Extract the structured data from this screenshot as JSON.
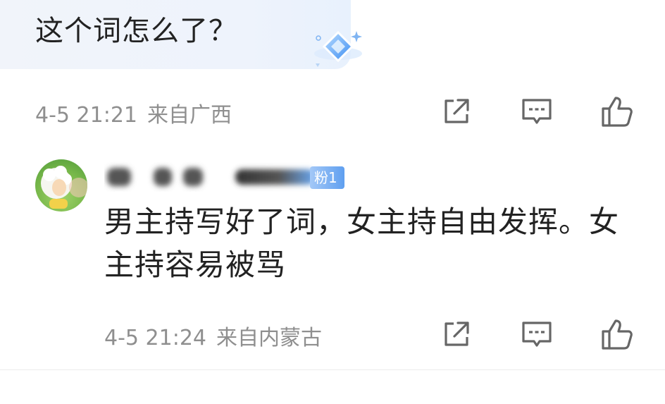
{
  "comment": {
    "text": "这个词怎么了？",
    "time": "4-5 21:21",
    "location": "来自广西"
  },
  "reply": {
    "fan_badge": "粉1",
    "text": "男主持写好了词，女主持自由发挥。女主持容易被骂",
    "time": "4-5 21:24",
    "location": "来自内蒙古"
  },
  "icons": {
    "share": "share-icon",
    "comment": "comment-icon",
    "like": "thumbs-up-icon",
    "badge": "diamond-badge-icon"
  },
  "colors": {
    "meta": "#8f8f8f",
    "text": "#222222",
    "fan_badge": "#5f9ff0"
  }
}
